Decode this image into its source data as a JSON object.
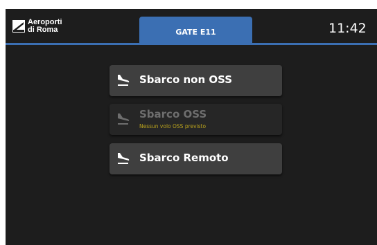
{
  "header": {
    "logo_line1": "Aeroporti",
    "logo_line2": "di Roma",
    "logo_mark_text": "ADR",
    "gate_label": "GATE E11",
    "time": "11:42"
  },
  "actions": [
    {
      "label": "Sbarco non OSS",
      "subtitle": "",
      "enabled": true,
      "icon": "plane-landing-icon"
    },
    {
      "label": "Sbarco OSS",
      "subtitle": "Nessun volo OSS previsto",
      "enabled": false,
      "icon": "plane-landing-icon"
    },
    {
      "label": "Sbarco Remoto",
      "subtitle": "",
      "enabled": true,
      "icon": "plane-landing-icon"
    }
  ],
  "colors": {
    "background": "#1d1d1d",
    "accent": "#3b6fb3",
    "button": "#3f3f3f",
    "disabled_text": "#6e6e6e",
    "warning_text": "#b9a21d"
  }
}
